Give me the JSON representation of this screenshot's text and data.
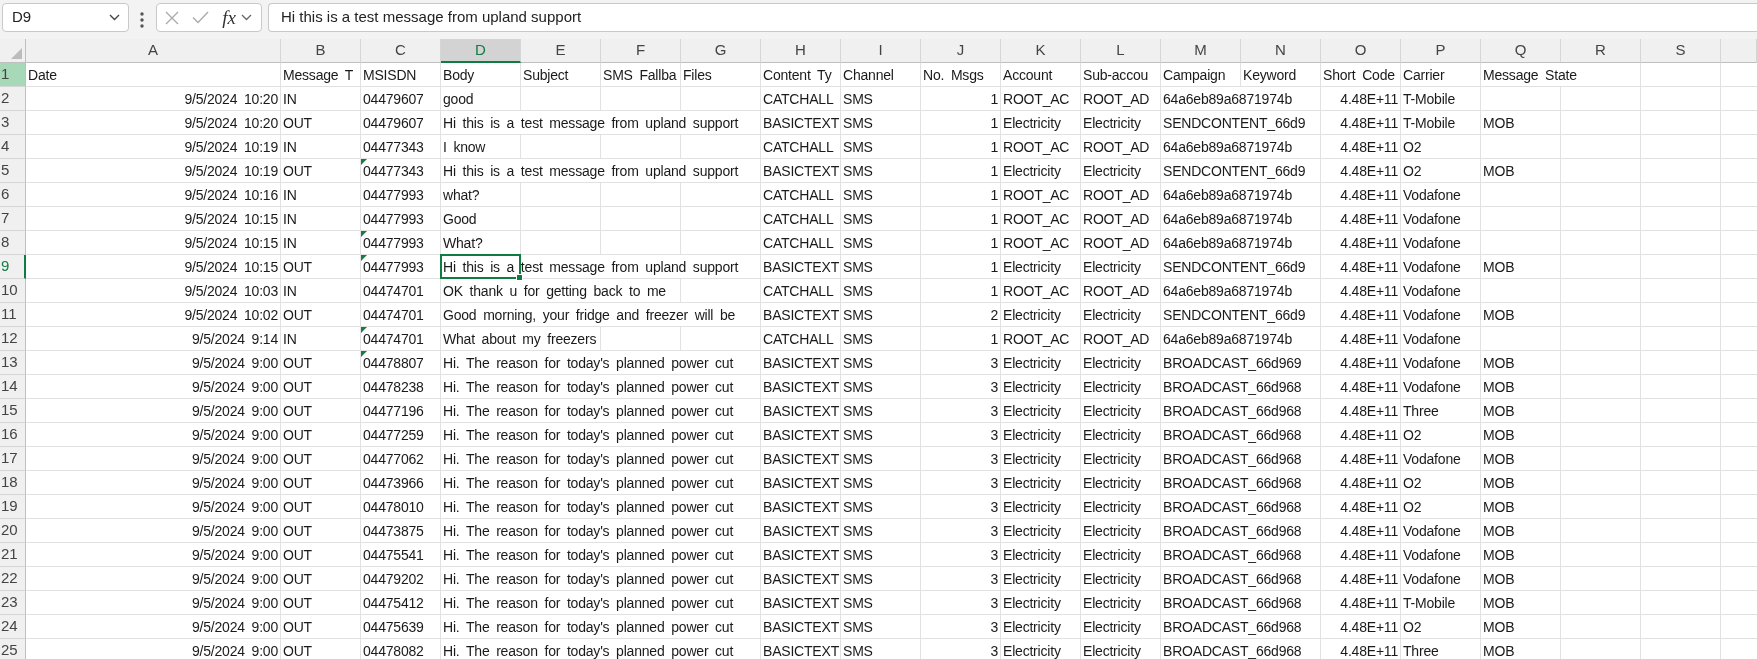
{
  "formula_bar": {
    "name_box": "D9",
    "buttons": [
      {
        "kind": "cancel",
        "disabled": true
      },
      {
        "kind": "enter",
        "disabled": true
      }
    ],
    "function_label": "fx",
    "formula": "Hi this is a test message from upland support"
  },
  "column_headers": [
    {
      "label": "A",
      "selected": false
    },
    {
      "label": "B",
      "selected": false
    },
    {
      "label": "C",
      "selected": false
    },
    {
      "label": "D",
      "selected": true
    },
    {
      "label": "E",
      "selected": false
    },
    {
      "label": "F",
      "selected": false
    },
    {
      "label": "G",
      "selected": false
    },
    {
      "label": "H",
      "selected": false
    },
    {
      "label": "I",
      "selected": false
    },
    {
      "label": "J",
      "selected": false
    },
    {
      "label": "K",
      "selected": false
    },
    {
      "label": "L",
      "selected": false
    },
    {
      "label": "M",
      "selected": false
    },
    {
      "label": "N",
      "selected": false
    },
    {
      "label": "O",
      "selected": false
    },
    {
      "label": "P",
      "selected": false
    },
    {
      "label": "Q",
      "selected": false
    },
    {
      "label": "R",
      "selected": false
    },
    {
      "label": "S",
      "selected": false
    }
  ],
  "sheet": {
    "rows": [
      {
        "number": "1",
        "kind": "header",
        "selected": false,
        "highlighted": true,
        "msisdn_error_flag": false,
        "cells": [
          "Date",
          "Message T",
          "MSISDN",
          "Body",
          "Subject",
          "SMS Fallba",
          "Files",
          "Content Ty",
          "Channel",
          "No. Msgs",
          "Account",
          "Sub-accou",
          "Campaign",
          "Keyword",
          "Short Code",
          "Carrier",
          "Message State"
        ]
      },
      {
        "number": "2",
        "kind": "data",
        "selected": false,
        "highlighted": false,
        "msisdn_error_flag": false,
        "cells": [
          "9/5/2024 10:20",
          "IN",
          "04479607",
          "good",
          "",
          "",
          "",
          "CATCHALL",
          "SMS",
          "1",
          "ROOT_AC",
          "ROOT_AD",
          "64a6eb89a6871974b",
          "",
          "4.48E+11",
          "T-Mobile"
        ]
      },
      {
        "number": "3",
        "kind": "data",
        "selected": false,
        "highlighted": false,
        "msisdn_error_flag": false,
        "cells": [
          "9/5/2024 10:20",
          "OUT",
          "04479607",
          "Hi this is a test message from upland support",
          "",
          "",
          "",
          "BASICTEXT",
          "SMS",
          "1",
          "Electricity",
          "Electricity",
          "SENDCONTENT_66d9",
          "",
          "4.48E+11",
          "T-Mobile",
          "MOB"
        ]
      },
      {
        "number": "4",
        "kind": "data",
        "selected": false,
        "highlighted": false,
        "msisdn_error_flag": false,
        "cells": [
          "9/5/2024 10:19",
          "IN",
          "04477343",
          "I know",
          "",
          "",
          "",
          "CATCHALL",
          "SMS",
          "1",
          "ROOT_AC",
          "ROOT_AD",
          "64a6eb89a6871974b",
          "",
          "4.48E+11",
          "O2"
        ]
      },
      {
        "number": "5",
        "kind": "data",
        "selected": false,
        "highlighted": false,
        "msisdn_error_flag": true,
        "cells": [
          "9/5/2024 10:19",
          "OUT",
          "04477343",
          "Hi this is a test message from upland support",
          "",
          "",
          "",
          "BASICTEXT",
          "SMS",
          "1",
          "Electricity",
          "Electricity",
          "SENDCONTENT_66d9",
          "",
          "4.48E+11",
          "O2",
          "MOB"
        ]
      },
      {
        "number": "6",
        "kind": "data",
        "selected": false,
        "highlighted": false,
        "msisdn_error_flag": false,
        "cells": [
          "9/5/2024 10:16",
          "IN",
          "04477993",
          "what?",
          "",
          "",
          "",
          "CATCHALL",
          "SMS",
          "1",
          "ROOT_AC",
          "ROOT_AD",
          "64a6eb89a6871974b",
          "",
          "4.48E+11",
          "Vodafone"
        ]
      },
      {
        "number": "7",
        "kind": "data",
        "selected": false,
        "highlighted": false,
        "msisdn_error_flag": false,
        "cells": [
          "9/5/2024 10:15",
          "IN",
          "04477993",
          "Good",
          "",
          "",
          "",
          "CATCHALL",
          "SMS",
          "1",
          "ROOT_AC",
          "ROOT_AD",
          "64a6eb89a6871974b",
          "",
          "4.48E+11",
          "Vodafone"
        ]
      },
      {
        "number": "8",
        "kind": "data",
        "selected": false,
        "highlighted": false,
        "msisdn_error_flag": true,
        "cells": [
          "9/5/2024 10:15",
          "IN",
          "04477993",
          "What?",
          "",
          "",
          "",
          "CATCHALL",
          "SMS",
          "1",
          "ROOT_AC",
          "ROOT_AD",
          "64a6eb89a6871974b",
          "",
          "4.48E+11",
          "Vodafone"
        ]
      },
      {
        "number": "9",
        "kind": "data",
        "selected": true,
        "highlighted": false,
        "msisdn_error_flag": true,
        "cells": [
          "9/5/2024 10:15",
          "OUT",
          "04477993",
          "Hi this is a test message from upland support",
          "",
          "",
          "",
          "BASICTEXT",
          "SMS",
          "1",
          "Electricity",
          "Electricity",
          "SENDCONTENT_66d9",
          "",
          "4.48E+11",
          "Vodafone",
          "MOB"
        ]
      },
      {
        "number": "10",
        "kind": "data",
        "selected": false,
        "highlighted": false,
        "msisdn_error_flag": false,
        "cells": [
          "9/5/2024 10:03",
          "IN",
          "04474701",
          "OK thank u for getting back to me",
          "",
          "",
          "",
          "CATCHALL",
          "SMS",
          "1",
          "ROOT_AC",
          "ROOT_AD",
          "64a6eb89a6871974b",
          "",
          "4.48E+11",
          "Vodafone"
        ]
      },
      {
        "number": "11",
        "kind": "data",
        "selected": false,
        "highlighted": false,
        "msisdn_error_flag": false,
        "cells": [
          "9/5/2024 10:02",
          "OUT",
          "04474701",
          "Good morning, your fridge and freezer will be",
          "",
          "",
          "",
          "BASICTEXT",
          "SMS",
          "2",
          "Electricity",
          "Electricity",
          "SENDCONTENT_66d9",
          "",
          "4.48E+11",
          "Vodafone",
          "MOB"
        ]
      },
      {
        "number": "12",
        "kind": "data",
        "selected": false,
        "highlighted": false,
        "msisdn_error_flag": true,
        "cells": [
          "9/5/2024 9:14",
          "IN",
          "04474701",
          "What about my freezers",
          "",
          "",
          "",
          "CATCHALL",
          "SMS",
          "1",
          "ROOT_AC",
          "ROOT_AD",
          "64a6eb89a6871974b",
          "",
          "4.48E+11",
          "Vodafone"
        ]
      },
      {
        "number": "13",
        "kind": "data",
        "selected": false,
        "highlighted": false,
        "msisdn_error_flag": true,
        "cells": [
          "9/5/2024 9:00",
          "OUT",
          "04478807",
          "Hi. The reason for today's planned power cut",
          "",
          "",
          "",
          "BASICTEXT",
          "SMS",
          "3",
          "Electricity",
          "Electricity",
          "BROADCAST_66d969",
          "",
          "4.48E+11",
          "Vodafone",
          "MOB"
        ]
      },
      {
        "number": "14",
        "kind": "data",
        "selected": false,
        "highlighted": false,
        "msisdn_error_flag": false,
        "cells": [
          "9/5/2024 9:00",
          "OUT",
          "04478238",
          "Hi. The reason for today's planned power cut",
          "",
          "",
          "",
          "BASICTEXT",
          "SMS",
          "3",
          "Electricity",
          "Electricity",
          "BROADCAST_66d968",
          "",
          "4.48E+11",
          "Vodafone",
          "MOB"
        ]
      },
      {
        "number": "15",
        "kind": "data",
        "selected": false,
        "highlighted": false,
        "msisdn_error_flag": false,
        "cells": [
          "9/5/2024 9:00",
          "OUT",
          "04477196",
          "Hi. The reason for today's planned power cut",
          "",
          "",
          "",
          "BASICTEXT",
          "SMS",
          "3",
          "Electricity",
          "Electricity",
          "BROADCAST_66d968",
          "",
          "4.48E+11",
          "Three",
          "MOB"
        ]
      },
      {
        "number": "16",
        "kind": "data",
        "selected": false,
        "highlighted": false,
        "msisdn_error_flag": false,
        "cells": [
          "9/5/2024 9:00",
          "OUT",
          "04477259",
          "Hi. The reason for today's planned power cut",
          "",
          "",
          "",
          "BASICTEXT",
          "SMS",
          "3",
          "Electricity",
          "Electricity",
          "BROADCAST_66d968",
          "",
          "4.48E+11",
          "O2",
          "MOB"
        ]
      },
      {
        "number": "17",
        "kind": "data",
        "selected": false,
        "highlighted": false,
        "msisdn_error_flag": false,
        "cells": [
          "9/5/2024 9:00",
          "OUT",
          "04477062",
          "Hi. The reason for today's planned power cut",
          "",
          "",
          "",
          "BASICTEXT",
          "SMS",
          "3",
          "Electricity",
          "Electricity",
          "BROADCAST_66d968",
          "",
          "4.48E+11",
          "Vodafone",
          "MOB"
        ]
      },
      {
        "number": "18",
        "kind": "data",
        "selected": false,
        "highlighted": false,
        "msisdn_error_flag": false,
        "cells": [
          "9/5/2024 9:00",
          "OUT",
          "04473966",
          "Hi. The reason for today's planned power cut",
          "",
          "",
          "",
          "BASICTEXT",
          "SMS",
          "3",
          "Electricity",
          "Electricity",
          "BROADCAST_66d968",
          "",
          "4.48E+11",
          "O2",
          "MOB"
        ]
      },
      {
        "number": "19",
        "kind": "data",
        "selected": false,
        "highlighted": false,
        "msisdn_error_flag": false,
        "cells": [
          "9/5/2024 9:00",
          "OUT",
          "04478010",
          "Hi. The reason for today's planned power cut",
          "",
          "",
          "",
          "BASICTEXT",
          "SMS",
          "3",
          "Electricity",
          "Electricity",
          "BROADCAST_66d968",
          "",
          "4.48E+11",
          "O2",
          "MOB"
        ]
      },
      {
        "number": "20",
        "kind": "data",
        "selected": false,
        "highlighted": false,
        "msisdn_error_flag": false,
        "cells": [
          "9/5/2024 9:00",
          "OUT",
          "04473875",
          "Hi. The reason for today's planned power cut",
          "",
          "",
          "",
          "BASICTEXT",
          "SMS",
          "3",
          "Electricity",
          "Electricity",
          "BROADCAST_66d968",
          "",
          "4.48E+11",
          "Vodafone",
          "MOB"
        ]
      },
      {
        "number": "21",
        "kind": "data",
        "selected": false,
        "highlighted": false,
        "msisdn_error_flag": false,
        "cells": [
          "9/5/2024 9:00",
          "OUT",
          "04475541",
          "Hi. The reason for today's planned power cut",
          "",
          "",
          "",
          "BASICTEXT",
          "SMS",
          "3",
          "Electricity",
          "Electricity",
          "BROADCAST_66d968",
          "",
          "4.48E+11",
          "Vodafone",
          "MOB"
        ]
      },
      {
        "number": "22",
        "kind": "data",
        "selected": false,
        "highlighted": false,
        "msisdn_error_flag": false,
        "cells": [
          "9/5/2024 9:00",
          "OUT",
          "04479202",
          "Hi. The reason for today's planned power cut",
          "",
          "",
          "",
          "BASICTEXT",
          "SMS",
          "3",
          "Electricity",
          "Electricity",
          "BROADCAST_66d968",
          "",
          "4.48E+11",
          "Vodafone",
          "MOB"
        ]
      },
      {
        "number": "23",
        "kind": "data",
        "selected": false,
        "highlighted": false,
        "msisdn_error_flag": false,
        "cells": [
          "9/5/2024 9:00",
          "OUT",
          "04475412",
          "Hi. The reason for today's planned power cut",
          "",
          "",
          "",
          "BASICTEXT",
          "SMS",
          "3",
          "Electricity",
          "Electricity",
          "BROADCAST_66d968",
          "",
          "4.48E+11",
          "T-Mobile",
          "MOB"
        ]
      },
      {
        "number": "24",
        "kind": "data",
        "selected": false,
        "highlighted": false,
        "msisdn_error_flag": false,
        "cells": [
          "9/5/2024 9:00",
          "OUT",
          "04475639",
          "Hi. The reason for today's planned power cut",
          "",
          "",
          "",
          "BASICTEXT",
          "SMS",
          "3",
          "Electricity",
          "Electricity",
          "BROADCAST_66d968",
          "",
          "4.48E+11",
          "O2",
          "MOB"
        ]
      },
      {
        "number": "25",
        "kind": "data",
        "selected": false,
        "highlighted": false,
        "msisdn_error_flag": false,
        "cells": [
          "9/5/2024 9:00",
          "OUT",
          "04478082",
          "Hi. The reason for today's planned power cut",
          "",
          "",
          "",
          "BASICTEXT",
          "SMS",
          "3",
          "Electricity",
          "Electricity",
          "BROADCAST_66d968",
          "",
          "4.48E+11",
          "Three",
          "MOB"
        ]
      }
    ]
  }
}
